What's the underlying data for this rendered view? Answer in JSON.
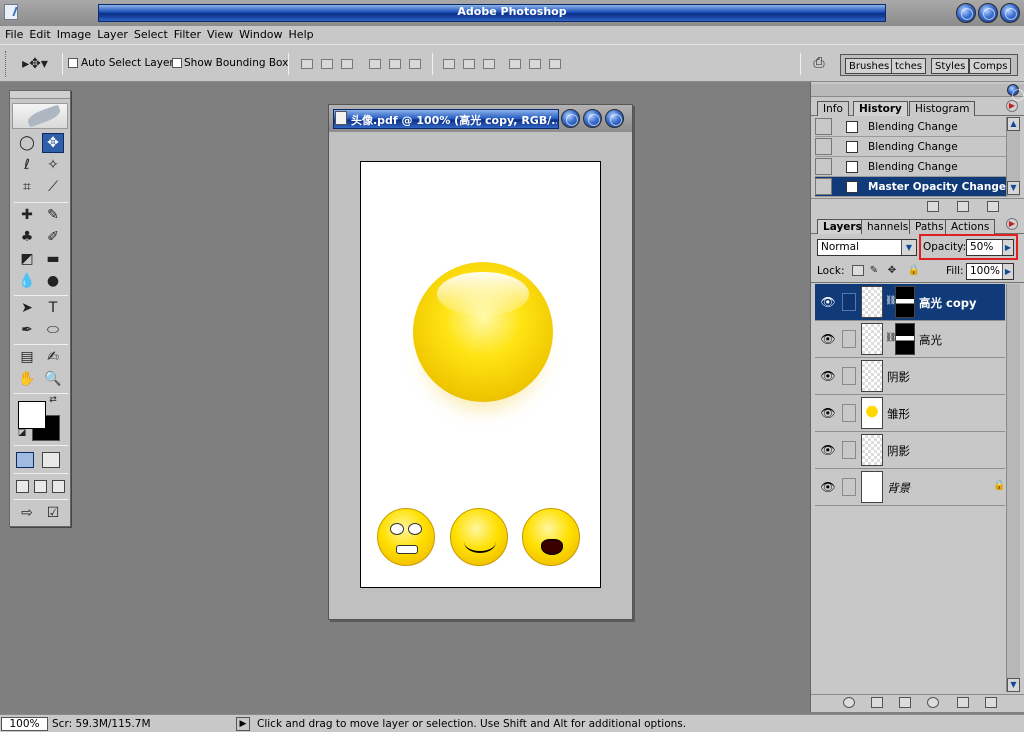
{
  "app": {
    "title": "Adobe Photoshop"
  },
  "menu": [
    "File",
    "Edit",
    "Image",
    "Layer",
    "Select",
    "Filter",
    "View",
    "Window",
    "Help"
  ],
  "options": {
    "auto_select_label": "Auto Select Layer",
    "bounding_box_label": "Show Bounding Box",
    "palette_tabs": [
      "Brushes",
      "tches",
      "Styles",
      "Comps"
    ]
  },
  "document": {
    "title": "头像.pdf @ 100% (高光 copy, RGB/..."
  },
  "history_panel": {
    "tabs": [
      "Info",
      "History",
      "Histogram"
    ],
    "active_tab": "History",
    "items": [
      {
        "label": "Blending Change",
        "selected": false
      },
      {
        "label": "Blending Change",
        "selected": false
      },
      {
        "label": "Blending Change",
        "selected": false
      },
      {
        "label": "Master Opacity Change",
        "selected": true
      }
    ]
  },
  "layers_panel": {
    "tabs": [
      "Layers",
      "hannels",
      "Paths",
      "Actions"
    ],
    "active_tab": "Layers",
    "blend_mode": "Normal",
    "opacity_label": "Opacity:",
    "opacity_value": "50%",
    "lock_label": "Lock:",
    "fill_label": "Fill:",
    "fill_value": "100%",
    "layers": [
      {
        "name": "高光 copy",
        "selected": true
      },
      {
        "name": "高光",
        "selected": false
      },
      {
        "name": "阴影",
        "selected": false
      },
      {
        "name": "雏形",
        "selected": false
      },
      {
        "name": "阴影",
        "selected": false
      },
      {
        "name": "背景",
        "selected": false
      }
    ]
  },
  "status": {
    "zoom": "100%",
    "scratch": "Scr: 59.3M/115.7M",
    "message": "Click and drag to move layer or selection.  Use Shift and Alt for additional options."
  },
  "colors": {
    "accent": "#103a78",
    "highlight_box": "#e02020",
    "foreground": "#ffffff",
    "background": "#000000"
  }
}
